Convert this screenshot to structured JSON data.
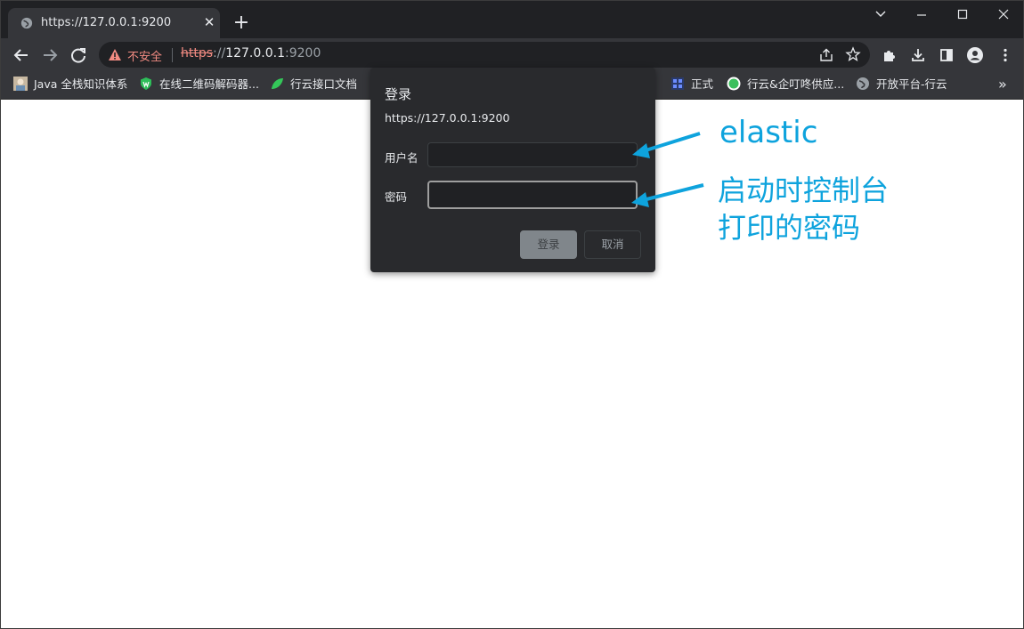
{
  "tab": {
    "title": "https://127.0.0.1:9200",
    "close_glyph": "✕"
  },
  "new_tab_glyph": "+",
  "window_controls": {
    "minimize": "—",
    "maximize": "☐",
    "close": "✕",
    "list": "⌄"
  },
  "omnibox": {
    "security_label": "不安全",
    "url_scheme": "https",
    "url_slashes": "://",
    "url_host": "127.0.0.1",
    "url_port": ":9200"
  },
  "bookmarks": [
    {
      "label": "Java 全栈知识体系",
      "icon": "avatar-icon"
    },
    {
      "label": "在线二维码解码器...",
      "icon": "shield-icon"
    },
    {
      "label": "行云接口文档",
      "icon": "leaf-icon"
    },
    {
      "label": "正式",
      "icon": "grid-icon"
    },
    {
      "label": "行云&企叮咚供应...",
      "icon": "circle-icon"
    },
    {
      "label": "开放平台-行云",
      "icon": "globe-icon"
    }
  ],
  "bookmarks_overflow": "»",
  "dialog": {
    "title": "登录",
    "origin": "https://127.0.0.1:9200",
    "username_label": "用户名",
    "username_value": "",
    "password_label": "密码",
    "password_value": "",
    "login_button": "登录",
    "cancel_button": "取消"
  },
  "annotations": {
    "username_note": "elastic",
    "password_note_line1": "启动时控制台",
    "password_note_line2": "打印的密码",
    "color": "#0ea3dd"
  },
  "colors": {
    "tabstrip_bg": "#202124",
    "toolbar_bg": "#35363a",
    "dialog_bg": "#292a2d",
    "insecure_red": "#f28b82"
  }
}
